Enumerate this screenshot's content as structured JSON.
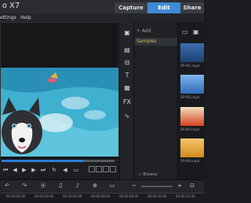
{
  "window": {
    "title": "o X7"
  },
  "tabs": [
    {
      "label": "Capture",
      "active": false
    },
    {
      "label": "Edit",
      "active": true
    },
    {
      "label": "Share",
      "active": false
    }
  ],
  "menu": {
    "settings": "ettings",
    "help": "Help"
  },
  "library": {
    "add_label": "Add",
    "selected_folder": "Samples",
    "browse_label": "Browse"
  },
  "thumbnails": [
    {
      "label": "SP-V01.mp4"
    },
    {
      "label": "SP-V02.mp4"
    },
    {
      "label": "SP-V03.mp4"
    },
    {
      "label": "SP-V04.mp4"
    }
  ],
  "timeline": {
    "ruler": [
      "00:00:00:00",
      "00:00:02:00",
      "00:00:04:00",
      "00:00:06:00",
      "00:00:08:00",
      "00:00:10:00",
      "00:00:12:00"
    ]
  },
  "colors": {
    "accent": "#3f8ad6",
    "folder": "#e0b85a"
  },
  "playback": {
    "progress": 0.72
  }
}
